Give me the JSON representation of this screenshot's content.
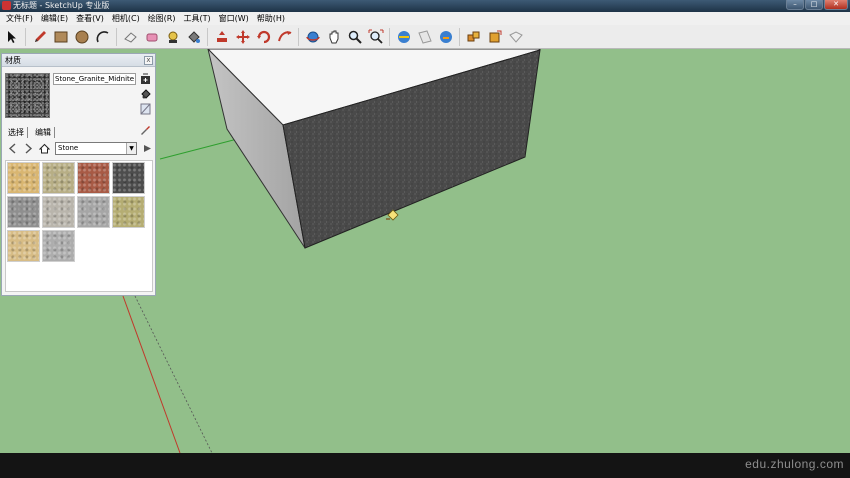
{
  "window": {
    "title": "无标题 - SketchUp 专业版"
  },
  "menu": [
    "文件(F)",
    "编辑(E)",
    "查看(V)",
    "相机(C)",
    "绘图(R)",
    "工具(T)",
    "窗口(W)",
    "帮助(H)"
  ],
  "toolbar": {
    "tools": [
      {
        "name": "select-tool-icon"
      },
      {
        "name": "pencil-tool-icon"
      },
      {
        "name": "rectangle-tool-icon"
      },
      {
        "name": "circle-tool-icon"
      },
      {
        "name": "arc-tool-icon"
      },
      {
        "name": "eraser-tool-icon"
      },
      {
        "name": "tape-measure-tool-icon"
      },
      {
        "name": "text-tool-icon"
      },
      {
        "name": "paint-bucket-tool-icon"
      },
      {
        "name": "push-pull-tool-icon"
      },
      {
        "name": "move-tool-icon"
      },
      {
        "name": "rotate-tool-icon"
      },
      {
        "name": "follow-me-tool-icon"
      },
      {
        "name": "orbit-tool-icon"
      },
      {
        "name": "pan-tool-icon"
      },
      {
        "name": "zoom-tool-icon"
      },
      {
        "name": "zoom-extents-tool-icon"
      },
      {
        "name": "warehouse-icon"
      },
      {
        "name": "share-model-icon"
      },
      {
        "name": "get-models-icon"
      },
      {
        "name": "components-icon"
      },
      {
        "name": "share-component-icon"
      },
      {
        "name": "extension-warehouse-icon"
      }
    ]
  },
  "materials_panel": {
    "title": "材质",
    "close_label": "x",
    "material_name": "Stone_Granite_Midnite",
    "tabs": [
      "选择",
      "编辑"
    ],
    "library": "Stone",
    "tiles": [
      {
        "name": "tile-sandstone",
        "color": "#d9b671"
      },
      {
        "name": "tile-pale-stone",
        "color": "#b7ae85"
      },
      {
        "name": "tile-red-stone",
        "color": "#a85a45"
      },
      {
        "name": "tile-dark-granite",
        "color": "#4d4d4d"
      },
      {
        "name": "tile-gray-stone",
        "color": "#8f8f8f"
      },
      {
        "name": "tile-stone-blocks",
        "color": "#b9b5ac"
      },
      {
        "name": "tile-light-granite",
        "color": "#a6a6a6"
      },
      {
        "name": "tile-moss-stone",
        "color": "#b5ad73"
      },
      {
        "name": "tile-tan-marble",
        "color": "#d7bc85"
      },
      {
        "name": "tile-gray-marble",
        "color": "#adadad"
      }
    ]
  },
  "viewport": {
    "background": "#92bf8a"
  },
  "watermark": "edu.zhulong.com"
}
